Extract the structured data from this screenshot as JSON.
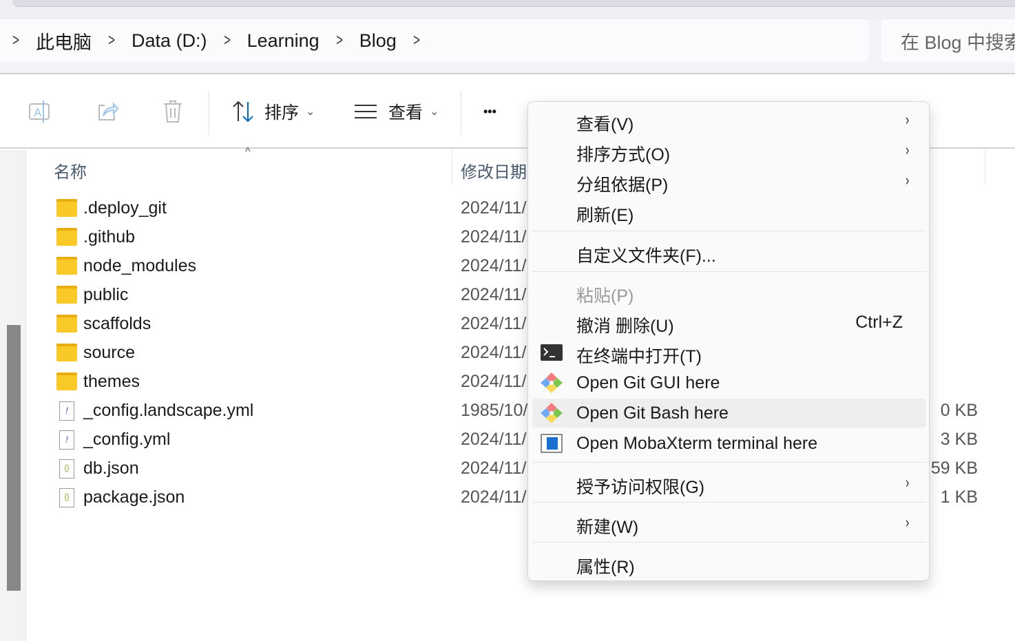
{
  "breadcrumb": {
    "items": [
      "此电脑",
      "Data (D:)",
      "Learning",
      "Blog"
    ]
  },
  "search": {
    "placeholder": "在 Blog 中搜索"
  },
  "toolbar": {
    "sort_label": "排序",
    "view_label": "查看",
    "more_label": "•••"
  },
  "columns": {
    "name": "名称",
    "date": "修改日期"
  },
  "files": [
    {
      "name": ".deploy_git",
      "date": "2024/11/",
      "type": "folder",
      "size": ""
    },
    {
      "name": ".github",
      "date": "2024/11/",
      "type": "folder",
      "size": ""
    },
    {
      "name": "node_modules",
      "date": "2024/11/",
      "type": "folder",
      "size": ""
    },
    {
      "name": "public",
      "date": "2024/11/",
      "type": "folder",
      "size": ""
    },
    {
      "name": "scaffolds",
      "date": "2024/11/",
      "type": "folder",
      "size": ""
    },
    {
      "name": "source",
      "date": "2024/11/",
      "type": "folder",
      "size": ""
    },
    {
      "name": "themes",
      "date": "2024/11/",
      "type": "folder",
      "size": ""
    },
    {
      "name": "_config.landscape.yml",
      "date": "1985/10/",
      "type": "yml",
      "size": "0 KB"
    },
    {
      "name": "_config.yml",
      "date": "2024/11/",
      "type": "yml",
      "size": "3 KB"
    },
    {
      "name": "db.json",
      "date": "2024/11/",
      "type": "json",
      "size": "59 KB"
    },
    {
      "name": "package.json",
      "date": "2024/11/",
      "type": "json",
      "size": "1 KB"
    }
  ],
  "context_menu": {
    "items": [
      {
        "label": "查看(V)",
        "submenu": true
      },
      {
        "label": "排序方式(O)",
        "submenu": true
      },
      {
        "label": "分组依据(P)",
        "submenu": true
      },
      {
        "label": "刷新(E)"
      },
      {
        "label": "自定义文件夹(F)..."
      },
      {
        "label": "粘贴(P)",
        "disabled": true
      },
      {
        "label": "撤消 删除(U)",
        "shortcut": "Ctrl+Z"
      },
      {
        "label": "在终端中打开(T)",
        "icon": "terminal-icon"
      },
      {
        "label": "Open Git GUI here",
        "icon": "git-icon"
      },
      {
        "label": "Open Git Bash here",
        "icon": "git-icon",
        "highlighted": true
      },
      {
        "label": "Open MobaXterm terminal here",
        "icon": "mobaxterm-icon"
      },
      {
        "label": "授予访问权限(G)",
        "submenu": true
      },
      {
        "label": "新建(W)",
        "submenu": true
      },
      {
        "label": "属性(R)"
      }
    ],
    "arrow": "›"
  },
  "colors": {
    "accent": "#0067c0",
    "folder": "#f9c928"
  }
}
